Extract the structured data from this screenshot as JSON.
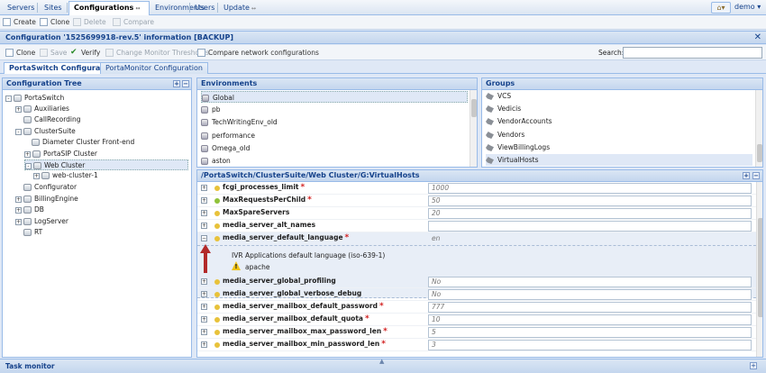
{
  "nav": {
    "tabs": [
      "Servers",
      "Sites",
      "Configurations",
      "Environments",
      "Users",
      "Update"
    ],
    "active": "Configurations",
    "user": "demo"
  },
  "toolbar1": {
    "create": "Create",
    "clone": "Clone",
    "delete": "Delete",
    "compare": "Compare"
  },
  "panel": {
    "title": "Configuration '1525699918-rev.5' information [BACKUP]"
  },
  "toolbar2": {
    "clone": "Clone",
    "save": "Save",
    "verify": "Verify",
    "change_thresholds": "Change Monitor Thresholds",
    "compare_network": "Compare network configurations",
    "search_label": "Search:",
    "search_value": ""
  },
  "subtabs": [
    "PortaSwitch Configuration",
    "PortaMonitor Configuration"
  ],
  "tree": {
    "title": "Configuration Tree",
    "items": [
      {
        "label": "PortaSwitch",
        "toggle": "-"
      },
      {
        "label": "Auxiliaries",
        "toggle": "+"
      },
      {
        "label": "CallRecording",
        "toggle": ""
      },
      {
        "label": "ClusterSuite",
        "toggle": "-"
      },
      {
        "label": "Diameter Cluster Front-end",
        "toggle": ""
      },
      {
        "label": "PortaSIP Cluster",
        "toggle": "+"
      },
      {
        "label": "Web Cluster",
        "toggle": "-"
      },
      {
        "label": "web-cluster-1",
        "toggle": "+"
      },
      {
        "label": "Configurator",
        "toggle": ""
      },
      {
        "label": "BillingEngine",
        "toggle": "+"
      },
      {
        "label": "DB",
        "toggle": "+"
      },
      {
        "label": "LogServer",
        "toggle": "+"
      },
      {
        "label": "RT",
        "toggle": ""
      }
    ]
  },
  "environments": {
    "title": "Environments",
    "items": [
      "Global",
      "pb",
      "TechWritingEnv_old",
      "performance",
      "Omega_old",
      "aston"
    ]
  },
  "groups": {
    "title": "Groups",
    "items": [
      "VCS",
      "Vedicis",
      "VendorAccounts",
      "Vendors",
      "ViewBillingLogs",
      "VirtualHosts"
    ]
  },
  "params": {
    "path": "/PortaSwitch/ClusterSuite/Web Cluster/G:VirtualHosts",
    "rows": [
      {
        "name": "fcgi_processes_limit",
        "required": true,
        "value": "1000",
        "dot": "#e8c23a"
      },
      {
        "name": "MaxRequestsPerChild",
        "required": true,
        "value": "50",
        "dot": "#8fc23a"
      },
      {
        "name": "MaxSpareServers",
        "required": false,
        "value": "20",
        "dot": "#e8c23a"
      },
      {
        "name": "media_server_alt_names",
        "required": false,
        "value": "",
        "dot": "#e8c23a"
      },
      {
        "name": "media_server_default_language",
        "required": true,
        "value": "en",
        "dot": "#e8c23a"
      },
      {
        "name": "media_server_global_profiling",
        "required": false,
        "value": "No",
        "dot": "#e8c23a"
      },
      {
        "name": "media_server_global_verbose_debug",
        "required": false,
        "value": "No",
        "dot": "#e8c23a"
      },
      {
        "name": "media_server_mailbox_default_password",
        "required": true,
        "value": "777",
        "dot": "#e8c23a"
      },
      {
        "name": "media_server_mailbox_default_quota",
        "required": true,
        "value": "10",
        "dot": "#e8c23a"
      },
      {
        "name": "media_server_mailbox_max_password_len",
        "required": true,
        "value": "5",
        "dot": "#e8c23a"
      },
      {
        "name": "media_server_mailbox_min_password_len",
        "required": true,
        "value": "3",
        "dot": "#e8c23a"
      }
    ],
    "expanded_description": "IVR Applications default language (iso-639-1)",
    "expanded_note": "apache"
  },
  "taskmonitor": {
    "title": "Task monitor"
  }
}
